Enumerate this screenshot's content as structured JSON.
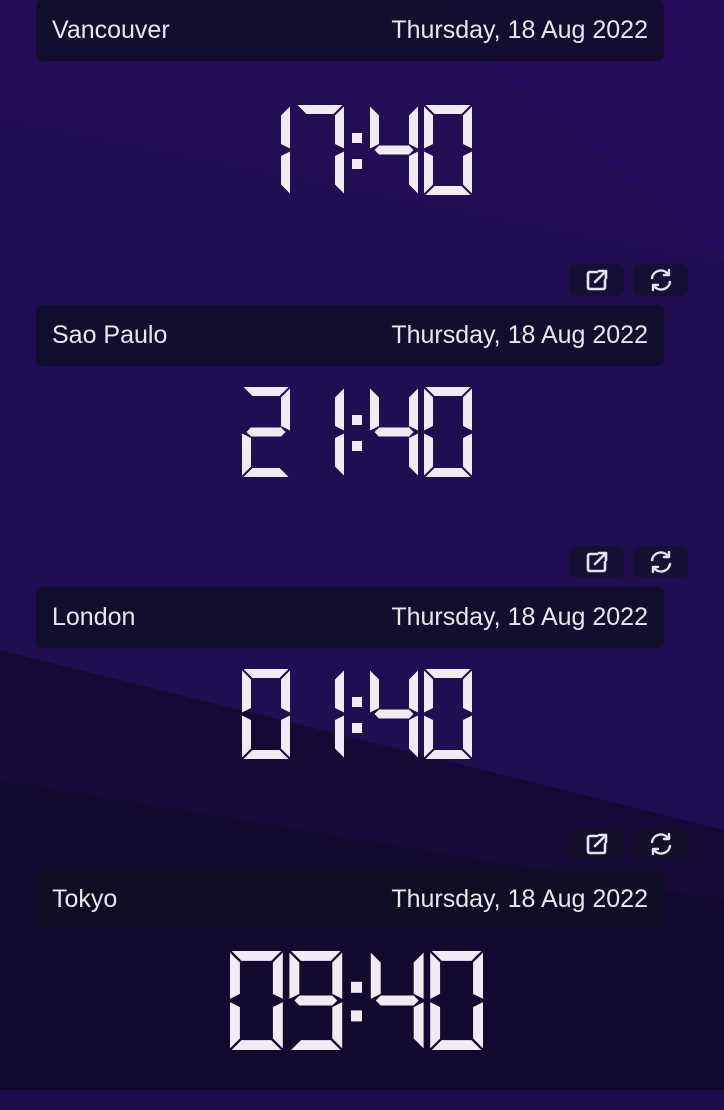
{
  "clocks": [
    {
      "city": "Vancouver",
      "date": "Thursday, 18 Aug 2022",
      "time": "17:40"
    },
    {
      "city": "Sao Paulo",
      "date": "Thursday, 18 Aug 2022",
      "time": "21:40"
    },
    {
      "city": "London",
      "date": "Thursday, 18 Aug 2022",
      "time": "01:40"
    },
    {
      "city": "Tokyo",
      "date": "Thursday, 18 Aug 2022",
      "time": "09:40"
    }
  ],
  "icons": {
    "open": "external-link-icon",
    "sync": "refresh-icon"
  },
  "colors": {
    "background": "#1d0c4a",
    "panel": "#0e0e22",
    "digits": "#f1ebf4",
    "text": "#e7e7ee"
  }
}
